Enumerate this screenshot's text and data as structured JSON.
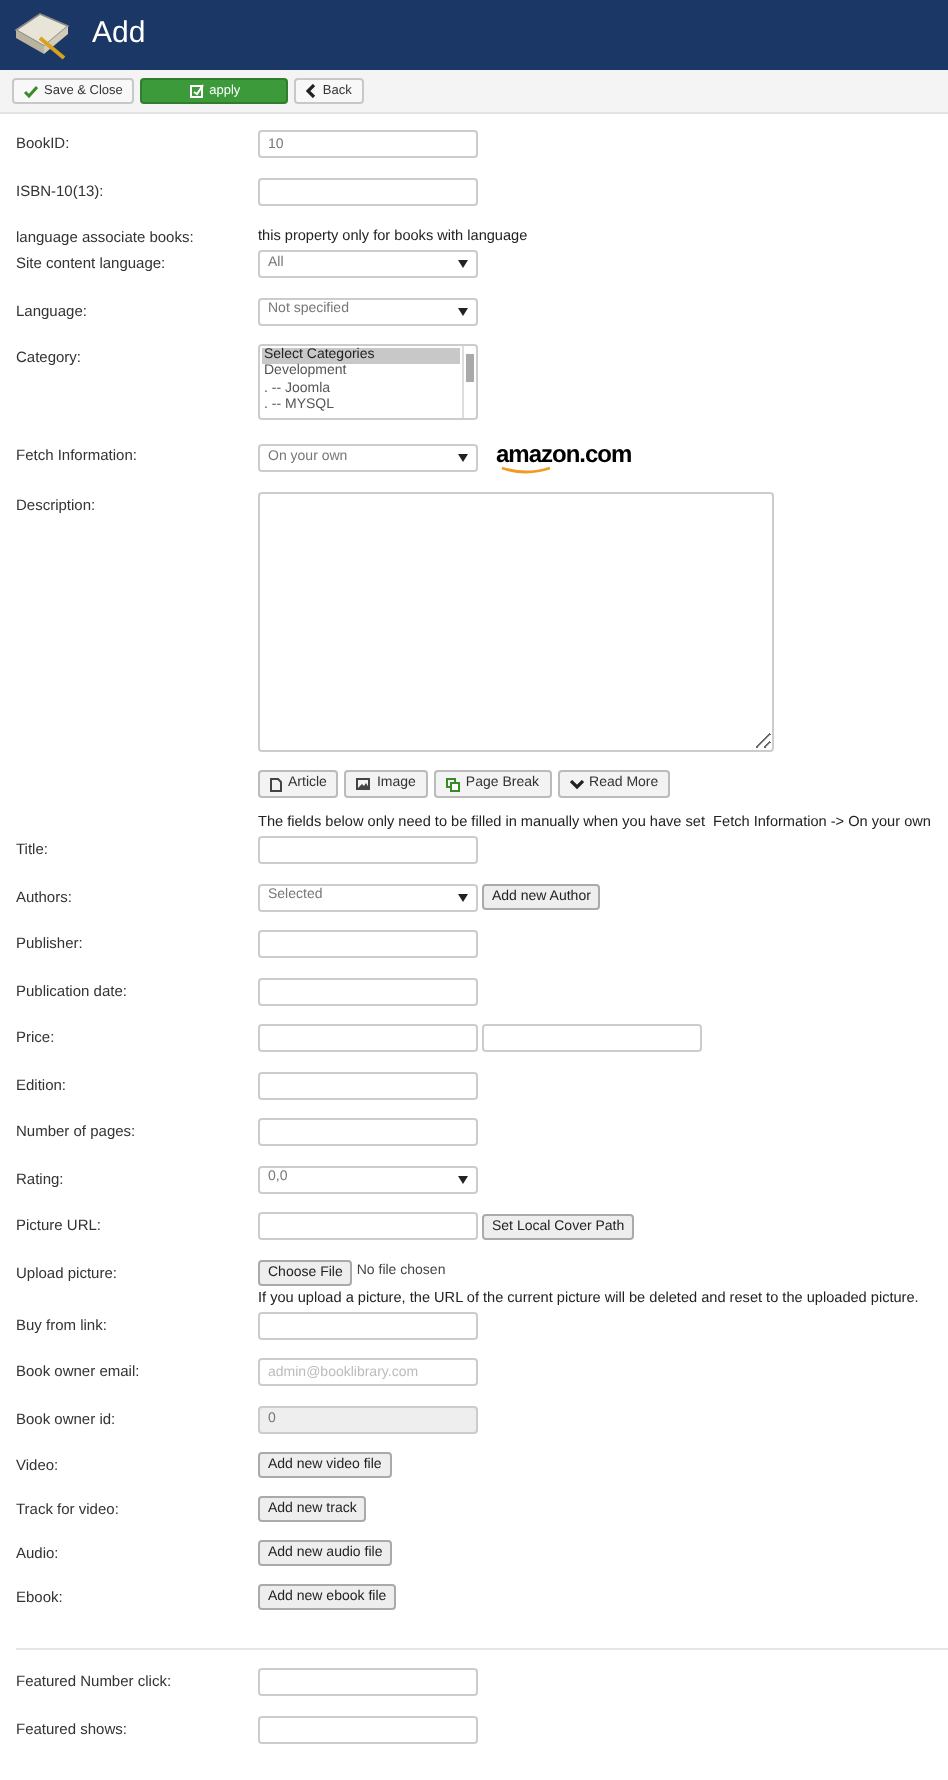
{
  "header": {
    "title": "Add"
  },
  "toolbar": [
    {
      "label": "Save & Close",
      "kind": "save"
    },
    {
      "label": "apply",
      "kind": "apply"
    },
    {
      "label": "Back",
      "kind": "back"
    }
  ],
  "rows": [
    {
      "kind": "input",
      "label": "BookID:",
      "value": "10"
    },
    {
      "kind": "input",
      "label": "ISBN-10(13):"
    },
    {
      "kind": "note",
      "label": "language associate books:",
      "text": "this property only for books with language"
    },
    {
      "kind": "select",
      "label": "Site content language:",
      "value": "All"
    },
    {
      "kind": "select",
      "label": "Language:",
      "value": "Not specified"
    },
    {
      "kind": "listbox",
      "label": "Category:",
      "options": [
        {
          "text": "Select Categories",
          "selected": true
        },
        {
          "text": "Development",
          "selected": false
        },
        {
          "text": ". -- Joomla",
          "selected": false
        },
        {
          "text": ". -- MYSQL",
          "selected": false
        }
      ]
    },
    {
      "kind": "fetch",
      "label": "Fetch Information:",
      "value": "On your own",
      "logo": "amazon.com"
    },
    {
      "kind": "textarea",
      "label": "Description:"
    },
    {
      "kind": "editor",
      "buttons": [
        {
          "label": "Article",
          "kind": "article"
        },
        {
          "label": "Image",
          "kind": "image"
        },
        {
          "label": "Page Break",
          "kind": "pagebreak"
        },
        {
          "label": "Read More",
          "kind": "readmore"
        }
      ]
    },
    {
      "kind": "note",
      "text": "The fields below only need to be filled in manually when you have set  Fetch Information -> On your own"
    },
    {
      "kind": "input",
      "label": "Title:"
    },
    {
      "kind": "select_button",
      "label": "Authors:",
      "value": "Selected",
      "button": "Add new Author"
    },
    {
      "kind": "input",
      "label": "Publisher:"
    },
    {
      "kind": "input",
      "label": "Publication date:"
    },
    {
      "kind": "double_input",
      "label": "Price:"
    },
    {
      "kind": "input",
      "label": "Edition:"
    },
    {
      "kind": "input",
      "label": "Number of pages:"
    },
    {
      "kind": "select",
      "label": "Rating:",
      "value": "0,0"
    },
    {
      "kind": "input_button",
      "label": "Picture URL:",
      "button": "Set Local Cover Path"
    },
    {
      "kind": "file",
      "label": "Upload picture:",
      "button": "Choose File",
      "status": "No file chosen"
    },
    {
      "kind": "note",
      "text": "If you upload a picture, the URL of the current picture will be deleted and reset to the uploaded picture."
    },
    {
      "kind": "input",
      "label": "Buy from link:"
    },
    {
      "kind": "input",
      "label": "Book owner email:",
      "placeholder": "admin@booklibrary.com"
    },
    {
      "kind": "input",
      "label": "Book owner id:",
      "value": "0",
      "disabled": true
    },
    {
      "kind": "button",
      "label": "Video:",
      "button": "Add new video file"
    },
    {
      "kind": "button",
      "label": "Track for video:",
      "button": "Add new track"
    },
    {
      "kind": "button",
      "label": "Audio:",
      "button": "Add new audio file"
    },
    {
      "kind": "button",
      "label": "Ebook:",
      "button": "Add new ebook file"
    },
    {
      "kind": "divider"
    },
    {
      "kind": "input",
      "label": "Featured Number click:"
    },
    {
      "kind": "input",
      "label": "Featured shows:"
    }
  ]
}
